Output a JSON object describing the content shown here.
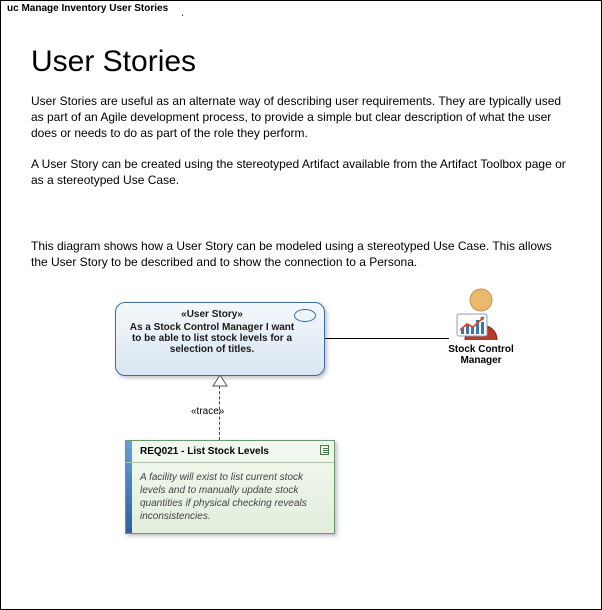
{
  "tab_title": "uc Manage Inventory User Stories",
  "heading": "User Stories",
  "para1": "User Stories are useful as an alternate way of describing user requirements.  They are typically used as part of an Agile development process, to provide a simple but clear description of what the user does or needs to do as part of the role they perform.",
  "para2": "A User Story can be created using the stereotyped Artifact available from the Artifact Toolbox page or as a stereotyped Use Case.",
  "para3": "This diagram shows how a User Story can be modeled using a stereotyped Use Case. This allows the User Story to be described and to show the connection to a Persona.",
  "usecase": {
    "stereotype": "«User Story»",
    "text": "As a Stock Control Manager I want to be able to list stock levels for a selection of titles."
  },
  "actor_label": "Stock Control Manager",
  "trace_label": "«trace»",
  "requirement": {
    "title": "REQ021 - List Stock Levels",
    "body": "A facility will exist to list current stock levels and to manually update stock quantities if physical checking reveals inconsistencies."
  }
}
